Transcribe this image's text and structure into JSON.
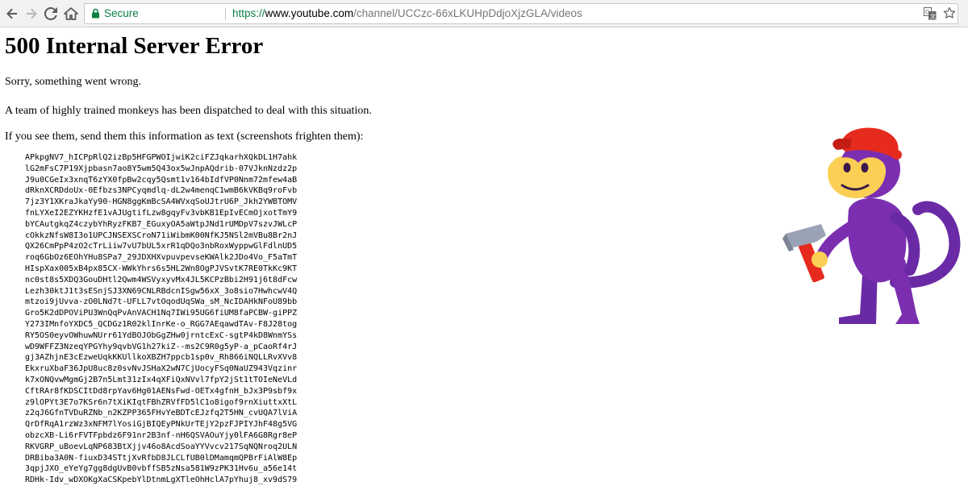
{
  "browser": {
    "secure_label": "Secure",
    "url_scheme": "https://",
    "url_host": "www.youtube.com",
    "url_path": "/channel/UCCzc-66xLKUHpDdjoXjzGLA/videos"
  },
  "page": {
    "heading": "500 Internal Server Error",
    "sorry_text": "Sorry, something went wrong.",
    "monkeys_text": "A team of highly trained monkeys has been dispatched to deal with this situation.",
    "instructions_text": "If you see them, send them this information as text (screenshots frighten them):",
    "error_lines": [
      "APkpgNV7_hICPpRlQ2izBp5HFGPWOIjwiK2ciFZJqkarhXQkDL1H7ahk",
      "lG2mFsC7P19Xjpbasn7ao8Y5wm5Q43ox5wJnpAQdrib-07VJknNzdz2p",
      "J9u0CGeIx3xnqT6zYX0fpBw2cqy5Qsmt1v164bIdfVP0Nnm72mfew4aB",
      "dRknXCRDdoUx-0Efbzs3NPCyqmdlq-dL2w4menqC1wmB6kVKBq9roFvb",
      "7jz3Y1XKraJkaYy90-HGN8ggKmBcSA4WVxqSoUJtrU6P_Jkh2YWBTOMV",
      "fnLYXeI2EZYKHzfE1vAJUgtifLzw8gqyFv3vbKB1EpIvECmOjxotTmY9",
      "bYCAutgkqZ4czybYhRyzFKB7_EGuxyOA5aWtpJNd1rUMDpV7szvJWLcP",
      "cOkkzNfsW8I3o1UPCJNSEXSCroN71iWibmK00NfKJ5NSl2mVBu8Br2nJ",
      "QX26CmPpP4zO2cTrLiiw7vU7bUL5xrR1qDQo3nbRoxWyppwGlFdlnUD5",
      "roq6GbOz6EOhYHu8SPa7_29JDXHXvpuvpevseKWAlk2JDo4Vo_F5aTmT",
      "HIspXax005xB4px85CX-WWkYhrs6s5HL2Wn8OgPJVSvtK7RE0TkKc9KT",
      "nc0st8s5XDQ3GouDHtl2Qwm4WSVyxyvMx4JL5KCPzBbi2H91j6t8dFcw",
      "Lezh30ktJ1t3sESnjSJ3XN69CNLRBdcnISgw56xX_3o8sio7HwhcwV4Q",
      "mtzoi9jUvva-zO0LNd7t-UFLL7vtOqodUqSWa_sM_NcIDAHkNFoU89bb",
      "Gro5K2dDPOViPU3WnQqPvAnVACH1Nq7IWi95UG6fiUM8faPCBW-giPPZ",
      "Y273IMnfoYXDC5_QCDGz1R02klInrKe-o_RGG7AEqawdTAv-F8J28tog",
      "RY5OS0eyvOWhuwNUrr61YdBOJObGgZHw0jrntcExC-sgtP4kD8WnmYSs",
      "wD9WFFZ3NzeqYPGYhy9qvbVG1h27kiZ--ms2C9R0g5yP-a_pCaoRf4rJ",
      "gj3AZhjnE3cEzweUqkKKUllkoXBZH7ppcb1sp0v_Rh866iNQLLRvXVv8",
      "EkxruXbaF36JpU8uc8z0svNvJSHaX2wN7CjUocyFSq0NaUZ943Vqzinr",
      "k7xONQvwMgmGj2B7n5Lmt31zIx4qXFiQxNVvl7fpY2jSt1tTOIeNeVLd",
      "CftRAr8fKDSCItDd8rpYav6Hg01AENsFwd-OETx4gfnH_bJx3P9sbf9x",
      "z9lOPYt3E7o7KSr6n7tXiKIqtFBhZRVfFD5lC1o8igof9rnXiuttxXtL",
      "z2qJ6GfnTVDuRZNb_n2KZPP365FHvYeBDTcEJzfq2T5HN_cvUQA7lViA",
      "QrDfRqA1rzWz3xNFM7lYosiGjBIQEyPNkUrTEjY2pzFJPIYJhF48g5VG",
      "obzcXB-Li6rFVTFpbdz6F91nr2B3nf-nH6QSVAOuYjy0lFA6G8Rgr8eP",
      "RKVGRP_uBoevLqNP683BtXjjv46o8AcdSoaYYVvcv217SqNQNroq2ULN",
      "DRBiba3A0N-fiuxD34STtjXvRfbD8JLCLfUB0lDMamqmQPBrFiAlW8Ep",
      "3qpjJXO_eYeYg7gg8dgUvB0vbffSB5zNsa581W9zPK31Hv6u_a56e14t",
      "RDHk-Idv_wDXOKgXaCSKpebYlDtnmLgXTleOhHclA7pYhuj8_xv9dS79"
    ]
  },
  "icons": {
    "back": "back-arrow-icon",
    "forward": "forward-arrow-icon",
    "reload": "reload-icon",
    "home": "home-icon",
    "lock": "lock-icon",
    "translate": "translate-icon",
    "star": "star-icon",
    "monkey": "monkey-with-hammer-illustration"
  },
  "colors": {
    "secure_green": "#0b8043",
    "monkey_purple": "#7b2fb0",
    "monkey_face": "#fbcf54",
    "hat_red": "#e62b1e"
  }
}
